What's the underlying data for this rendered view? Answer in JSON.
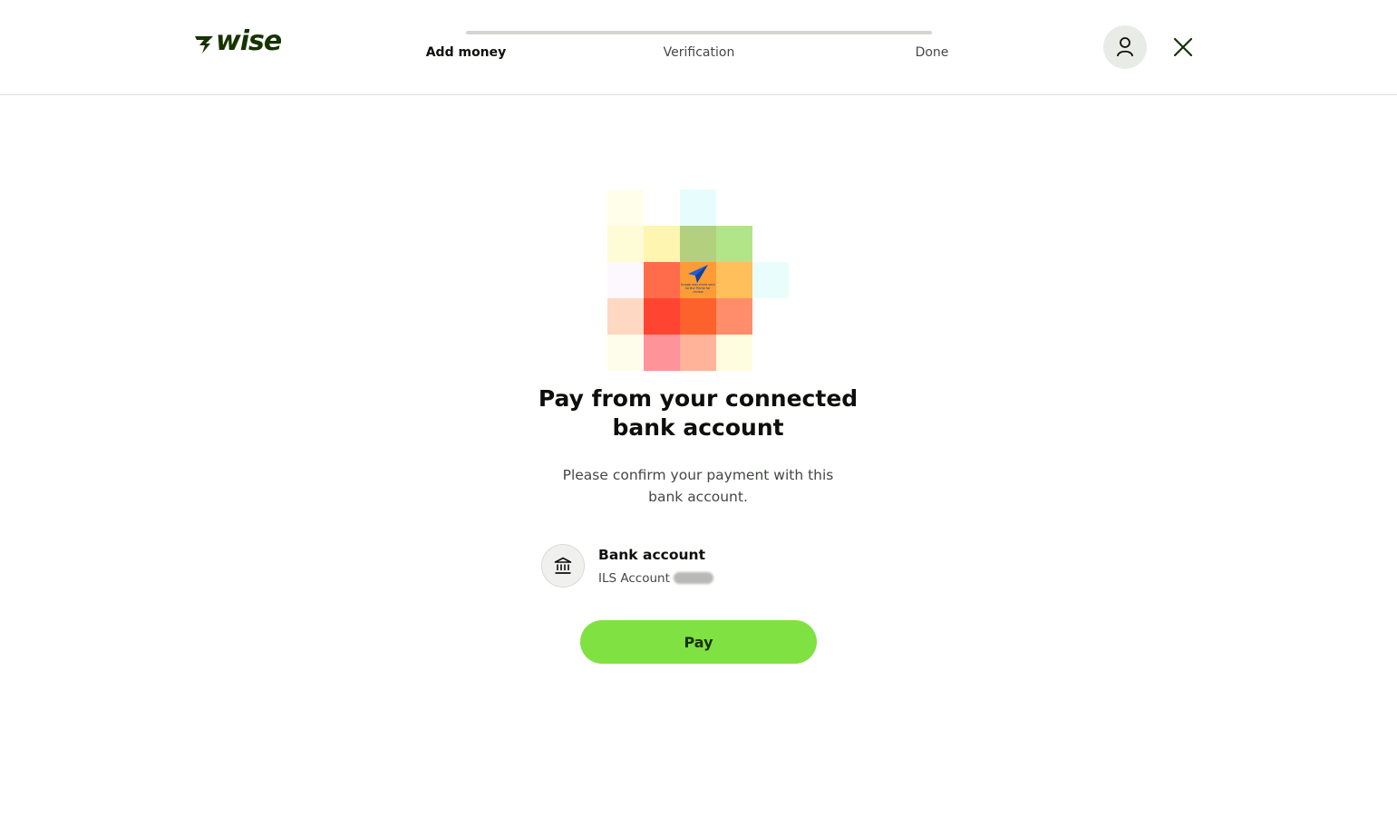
{
  "brand": {
    "name": "WISE",
    "primary_color": "#163300",
    "accent_color": "#80e142"
  },
  "progress": {
    "fraction_complete": 0.0,
    "steps": [
      {
        "label": "Add money",
        "active": true
      },
      {
        "label": "Verification",
        "active": false
      },
      {
        "label": "Done",
        "active": false
      }
    ]
  },
  "header": {
    "profile_icon": "user-icon",
    "close_icon": "close-icon"
  },
  "illustration": {
    "icon": "paper-plane-icon",
    "caption": "Image was more sent to the Prime for review",
    "tiles": [
      {
        "col": 0,
        "row": 0,
        "color": "#fefeea"
      },
      {
        "col": 2,
        "row": 0,
        "color": "#e7fdfd"
      },
      {
        "col": 0,
        "row": 1,
        "color": "#fefcd6"
      },
      {
        "col": 1,
        "row": 1,
        "color": "#fdf5b0"
      },
      {
        "col": 2,
        "row": 1,
        "color": "#b3d07e"
      },
      {
        "col": 3,
        "row": 1,
        "color": "#b2e588"
      },
      {
        "col": 0,
        "row": 2,
        "color": "#fdf8fd"
      },
      {
        "col": 1,
        "row": 2,
        "color": "#ff6c4c"
      },
      {
        "col": 2,
        "row": 2,
        "color": "#fd9c36"
      },
      {
        "col": 3,
        "row": 2,
        "color": "#ffbf5b"
      },
      {
        "col": 4,
        "row": 2,
        "color": "#eafdfd"
      },
      {
        "col": 0,
        "row": 3,
        "color": "#fed8c2"
      },
      {
        "col": 1,
        "row": 3,
        "color": "#ff4431"
      },
      {
        "col": 2,
        "row": 3,
        "color": "#fd612c"
      },
      {
        "col": 3,
        "row": 3,
        "color": "#ff8c6b"
      },
      {
        "col": 0,
        "row": 4,
        "color": "#fefdeb"
      },
      {
        "col": 1,
        "row": 4,
        "color": "#ff939a"
      },
      {
        "col": 2,
        "row": 4,
        "color": "#ffb49a"
      },
      {
        "col": 3,
        "row": 4,
        "color": "#fefde0"
      }
    ]
  },
  "main": {
    "title": "Pay from your connected bank account",
    "subtitle": "Please confirm your payment with this bank account.",
    "bank": {
      "icon": "bank-icon",
      "name": "Bank account",
      "detail": "ILS Account"
    },
    "pay_label": "Pay"
  }
}
